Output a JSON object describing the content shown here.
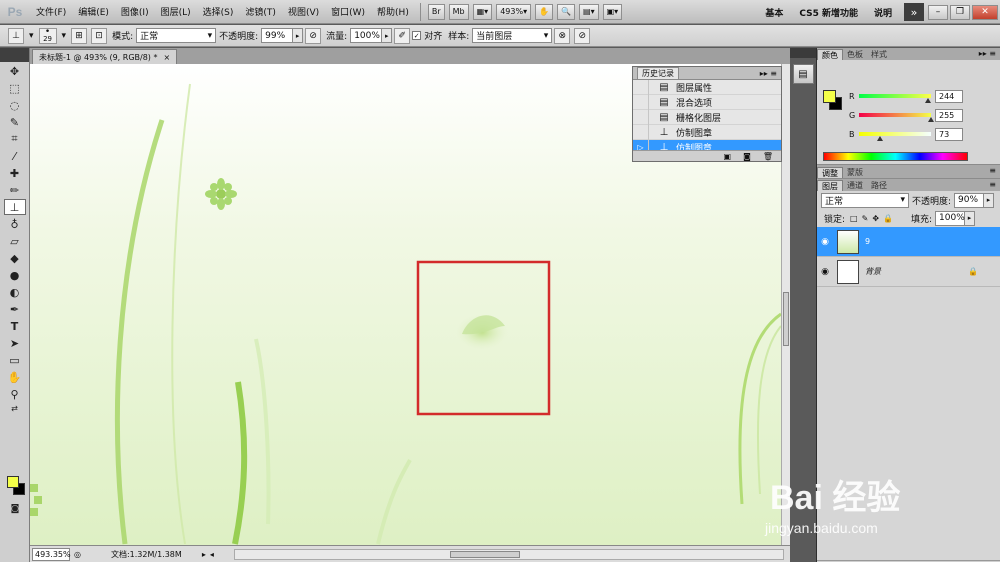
{
  "app": {
    "logo": "Ps"
  },
  "menu": [
    "文件(F)",
    "编辑(E)",
    "图像(I)",
    "图层(L)",
    "选择(S)",
    "滤镜(T)",
    "视图(V)",
    "窗口(W)",
    "帮助(H)"
  ],
  "menubar_buttons": {
    "bridge": "Br",
    "minibridge": "Mb",
    "zoom": "493%"
  },
  "workspace": {
    "basic": "基本",
    "cs5_new": "CS5 新增功能",
    "help": "说明",
    "more": "»"
  },
  "window_controls": {
    "minimize": "–",
    "restore": "❐",
    "close": "✕"
  },
  "options": {
    "brush_size": "29",
    "mode_label": "模式:",
    "mode_value": "正常",
    "opacity_label": "不透明度:",
    "opacity_value": "99%",
    "flow_label": "流量:",
    "flow_value": "100%",
    "aligned_label": "对齐",
    "sample_label": "样本:",
    "sample_value": "当前图层"
  },
  "document": {
    "tab_title": "未标题-1 @ 493% (9, RGB/8) *",
    "close": "×",
    "status_zoom": "493.35%",
    "status_doc": "文档:1.32M/1.38M"
  },
  "history": {
    "title": "历史记录",
    "items": [
      {
        "label": "图层属性",
        "selected": false
      },
      {
        "label": "混合选项",
        "selected": false
      },
      {
        "label": "栅格化图层",
        "selected": false
      },
      {
        "label": "仿制图章",
        "selected": false
      },
      {
        "label": "仿制图章",
        "selected": true
      }
    ]
  },
  "color_panel": {
    "tabs": [
      "颜色",
      "色板",
      "样式"
    ],
    "r_label": "R",
    "g_label": "G",
    "b_label": "B",
    "r": 244,
    "g": 255,
    "b": 73,
    "fg_color": "#f4ff49",
    "bg_color": "#000000"
  },
  "adjust_tabs": [
    "调整",
    "蒙版"
  ],
  "layers_panel": {
    "tabs": [
      "图层",
      "通道",
      "路径"
    ],
    "blend_mode": "正常",
    "opacity_label": "不透明度:",
    "opacity_value": "90%",
    "lock_label": "锁定:",
    "fill_label": "填充:",
    "fill_value": "100%",
    "layers": [
      {
        "name": "9",
        "selected": true
      },
      {
        "name": "背景",
        "selected": false,
        "locked": true
      }
    ]
  },
  "watermark": {
    "logo": "Bai 经验",
    "url": "jingyan.baidu.com"
  },
  "icons": [
    "clone-stamp-icon",
    "eye-icon",
    "lock-icon",
    "history-brush-icon",
    "trash-icon"
  ],
  "colors": {
    "selection": "#3399ff",
    "highlight_rect": "#d32b2b"
  }
}
